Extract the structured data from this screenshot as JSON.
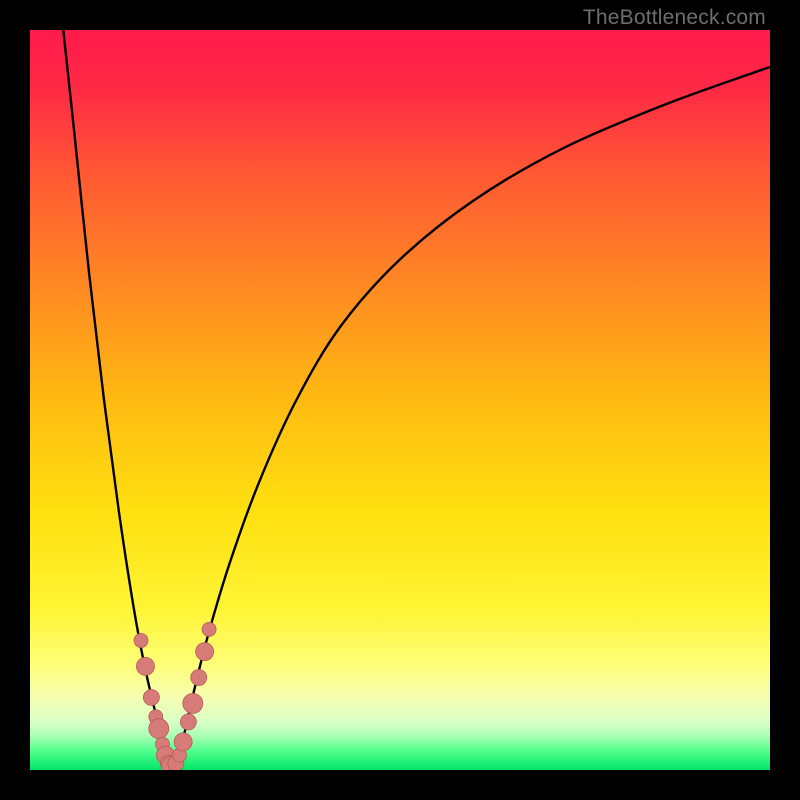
{
  "watermark": "TheBottleneck.com",
  "colors": {
    "black": "#000000",
    "curve": "#000000",
    "dot_fill": "#d77b79",
    "dot_stroke": "#b85a58",
    "gradient_stops": [
      {
        "offset": 0.0,
        "color": "#ff1a4b"
      },
      {
        "offset": 0.08,
        "color": "#ff2a45"
      },
      {
        "offset": 0.2,
        "color": "#ff5a33"
      },
      {
        "offset": 0.35,
        "color": "#ff8a22"
      },
      {
        "offset": 0.5,
        "color": "#ffba12"
      },
      {
        "offset": 0.65,
        "color": "#ffe010"
      },
      {
        "offset": 0.78,
        "color": "#fff433"
      },
      {
        "offset": 0.86,
        "color": "#fdff7a"
      },
      {
        "offset": 0.9,
        "color": "#f6ffb0"
      },
      {
        "offset": 0.935,
        "color": "#d9ffc6"
      },
      {
        "offset": 0.955,
        "color": "#a6ffb4"
      },
      {
        "offset": 0.975,
        "color": "#4eff8a"
      },
      {
        "offset": 1.0,
        "color": "#00e46a"
      }
    ]
  },
  "chart_data": {
    "type": "line",
    "title": "",
    "xlabel": "",
    "ylabel": "",
    "xlim": [
      0,
      100
    ],
    "ylim": [
      0,
      100
    ],
    "notch_x": 19,
    "series": [
      {
        "name": "bottleneck-curve",
        "x": [
          4.5,
          6,
          8,
          10,
          12,
          14,
          15.5,
          17,
          18,
          18.7,
          19,
          19.5,
          20,
          21,
          22,
          24,
          27,
          31,
          36,
          42,
          50,
          60,
          72,
          86,
          100
        ],
        "y": [
          100,
          86,
          67,
          50,
          35,
          22,
          14,
          7.5,
          3.2,
          1.0,
          0.3,
          0.8,
          2.0,
          5.5,
          10,
          18,
          28,
          39,
          50,
          60,
          69,
          77,
          84,
          90,
          95
        ]
      }
    ],
    "highlighted_points": {
      "name": "sample-dots",
      "points": [
        {
          "x": 15.0,
          "y": 17.5,
          "r": 7
        },
        {
          "x": 15.6,
          "y": 14.0,
          "r": 9
        },
        {
          "x": 16.4,
          "y": 9.8,
          "r": 8
        },
        {
          "x": 17.0,
          "y": 7.2,
          "r": 7
        },
        {
          "x": 17.4,
          "y": 5.6,
          "r": 10
        },
        {
          "x": 17.9,
          "y": 3.5,
          "r": 7
        },
        {
          "x": 18.3,
          "y": 2.0,
          "r": 9
        },
        {
          "x": 18.7,
          "y": 0.9,
          "r": 8
        },
        {
          "x": 19.1,
          "y": 0.5,
          "r": 10
        },
        {
          "x": 19.7,
          "y": 0.9,
          "r": 8
        },
        {
          "x": 20.2,
          "y": 2.0,
          "r": 7
        },
        {
          "x": 20.7,
          "y": 3.8,
          "r": 9
        },
        {
          "x": 21.4,
          "y": 6.5,
          "r": 8
        },
        {
          "x": 22.0,
          "y": 9.0,
          "r": 10
        },
        {
          "x": 22.8,
          "y": 12.5,
          "r": 8
        },
        {
          "x": 23.6,
          "y": 16.0,
          "r": 9
        },
        {
          "x": 24.2,
          "y": 19.0,
          "r": 7
        }
      ]
    }
  }
}
